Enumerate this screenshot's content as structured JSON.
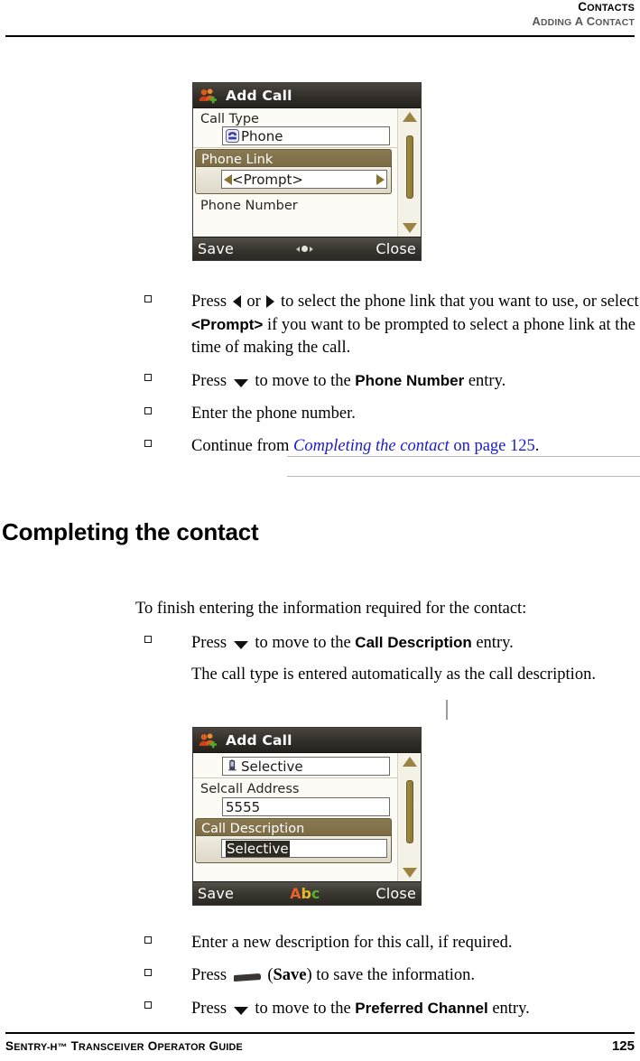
{
  "header": {
    "line1": "CONTACTS",
    "line2": "ADDING A CONTACT"
  },
  "footer": {
    "guide": "SENTRY-H™ TRANSCEIVER OPERATOR GUIDE",
    "page_number": "125"
  },
  "section_heading": "Completing the contact",
  "intro_paragraph": "To finish entering the information required for the contact:",
  "bullets_top": [
    {
      "id": "press-left-right-phone-link",
      "parts": [
        {
          "t": "text",
          "v": "Press "
        },
        {
          "t": "icon",
          "v": "arrow-left-icon"
        },
        {
          "t": "text",
          "v": " or "
        },
        {
          "t": "icon",
          "v": "arrow-right-icon"
        },
        {
          "t": "text",
          "v": " to select the phone link that you want to use, or select "
        },
        {
          "t": "bold-sans",
          "v": "<Prompt>"
        },
        {
          "t": "text",
          "v": " if you want to be prompted to select a phone link at the time of making the call."
        }
      ]
    },
    {
      "id": "press-down-phone-number",
      "parts": [
        {
          "t": "text",
          "v": "Press "
        },
        {
          "t": "icon",
          "v": "arrow-down-icon"
        },
        {
          "t": "text",
          "v": " to move to the "
        },
        {
          "t": "bold-sans",
          "v": "Phone Number"
        },
        {
          "t": "text",
          "v": " entry."
        }
      ]
    },
    {
      "id": "enter-phone-number",
      "parts": [
        {
          "t": "text",
          "v": "Enter the phone number."
        }
      ]
    },
    {
      "id": "continue-from-xref",
      "parts": [
        {
          "t": "text",
          "v": "Continue from "
        },
        {
          "t": "xref",
          "v": "Completing the contact"
        },
        {
          "t": "xref-plain",
          "v": " on page 125"
        },
        {
          "t": "text",
          "v": "."
        }
      ]
    }
  ],
  "bullets_mid": [
    {
      "id": "press-down-call-description",
      "parts": [
        {
          "t": "text",
          "v": "Press "
        },
        {
          "t": "icon",
          "v": "arrow-down-icon"
        },
        {
          "t": "text",
          "v": " to move to the "
        },
        {
          "t": "bold-sans",
          "v": "Call Description"
        },
        {
          "t": "text",
          "v": " entry."
        }
      ]
    }
  ],
  "note_paragraph": "The call type is entered automatically as the call description.",
  "bullets_bottom": [
    {
      "id": "enter-new-description",
      "parts": [
        {
          "t": "text",
          "v": "Enter a new description for this call, if required."
        }
      ]
    },
    {
      "id": "press-save-softkey",
      "parts": [
        {
          "t": "text",
          "v": "Press "
        },
        {
          "t": "icon",
          "v": "softkey-bar-icon"
        },
        {
          "t": "text",
          "v": " ("
        },
        {
          "t": "bold-serif",
          "v": "Save"
        },
        {
          "t": "text",
          "v": ") to save the information."
        }
      ]
    },
    {
      "id": "press-down-preferred-channel",
      "parts": [
        {
          "t": "text",
          "v": "Press "
        },
        {
          "t": "icon",
          "v": "arrow-down-icon"
        },
        {
          "t": "text",
          "v": " to move to the "
        },
        {
          "t": "bold-sans",
          "v": "Preferred Channel"
        },
        {
          "t": "text",
          "v": " entry."
        }
      ]
    }
  ],
  "screenshot_top": {
    "title": "Add Call",
    "title_icon": "add-contact-icon",
    "fields": [
      {
        "label": "Call Type",
        "selected": false,
        "value": "Phone",
        "icon": "telephone-icon",
        "spinner": false
      },
      {
        "label": "Phone Link",
        "selected": true,
        "value": "<Prompt>",
        "icon": null,
        "spinner": true
      },
      {
        "label": "Phone Number",
        "selected": false,
        "value": null,
        "icon": null,
        "spinner": false
      }
    ],
    "softkeys": {
      "left": "Save",
      "right": "Close"
    },
    "ime_indicator": "nav-dots-icon",
    "scrollbar": {
      "up": "scroll-up-arrow-icon",
      "down": "scroll-down-arrow-icon"
    }
  },
  "screenshot_bottom": {
    "title": "Add Call",
    "title_icon": "add-contact-icon",
    "fields": [
      {
        "label": null,
        "selected": false,
        "value": "Selective",
        "icon": "handset-icon",
        "spinner": false
      },
      {
        "label": "Selcall Address",
        "selected": false,
        "value": "5555",
        "icon": null,
        "spinner": false
      },
      {
        "label": "Call Description",
        "selected": true,
        "value": "Selective",
        "icon": null,
        "spinner": false,
        "highlighted": true
      }
    ],
    "softkeys": {
      "left": "Save",
      "right": "Close"
    },
    "ime_indicator": "abc-icon",
    "ime_text": "Abc",
    "scrollbar": {
      "up": "scroll-up-arrow-icon",
      "down": "scroll-down-arrow-icon"
    }
  },
  "colors": {
    "xref_link": "#1a1ad0",
    "header_sub": "#58585a",
    "device_title_bar": "#322e29",
    "device_selected_row": "#7b6c46",
    "device_scroll_accent": "#9a8440",
    "ime_a": "#e8622a",
    "ime_b": "#e8b82a",
    "ime_c": "#5ab02a"
  }
}
